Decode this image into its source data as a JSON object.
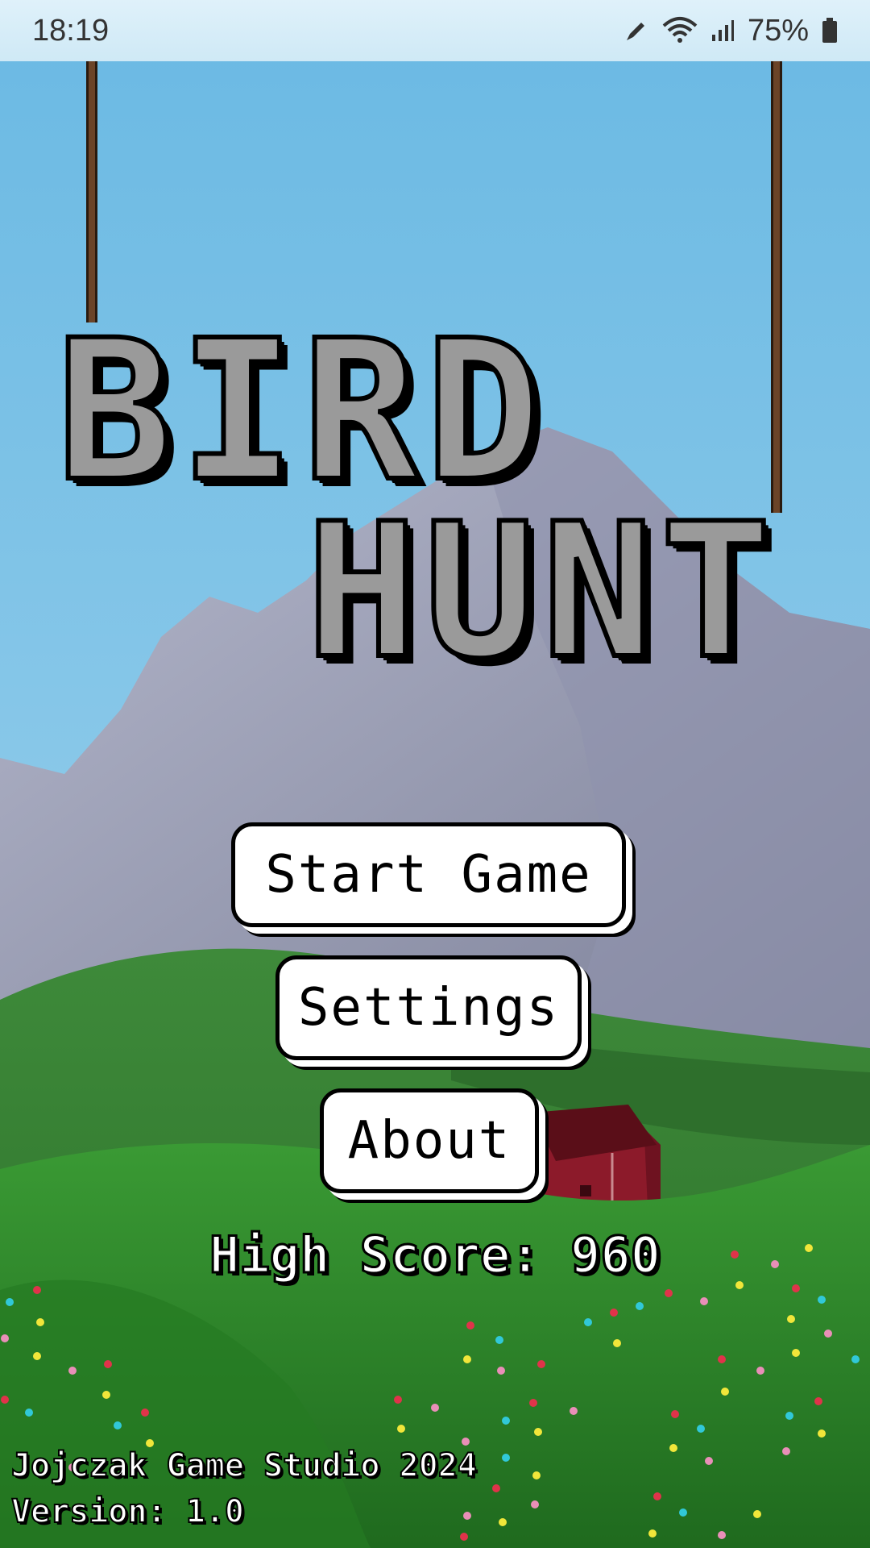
{
  "status_bar": {
    "time": "18:19",
    "battery": "75%",
    "icons": [
      "pen-icon",
      "wifi-icon",
      "signal-icon",
      "battery-icon"
    ]
  },
  "game": {
    "title_line1": "BIRD",
    "title_line2": "HUNT",
    "menu": {
      "start_label": "Start Game",
      "settings_label": "Settings",
      "about_label": "About"
    },
    "high_score_text": "High Score: 960",
    "credits": "Jojczak Game Studio 2024",
    "version": "Version: 1.0"
  },
  "colors": {
    "sky": "#7ec3e6",
    "mountain": "#9a9fb8",
    "grass": "#2f8a2a",
    "barn": "#8c1a2a",
    "title_fill": "#9a9a9a",
    "rope": "#6b4428"
  }
}
